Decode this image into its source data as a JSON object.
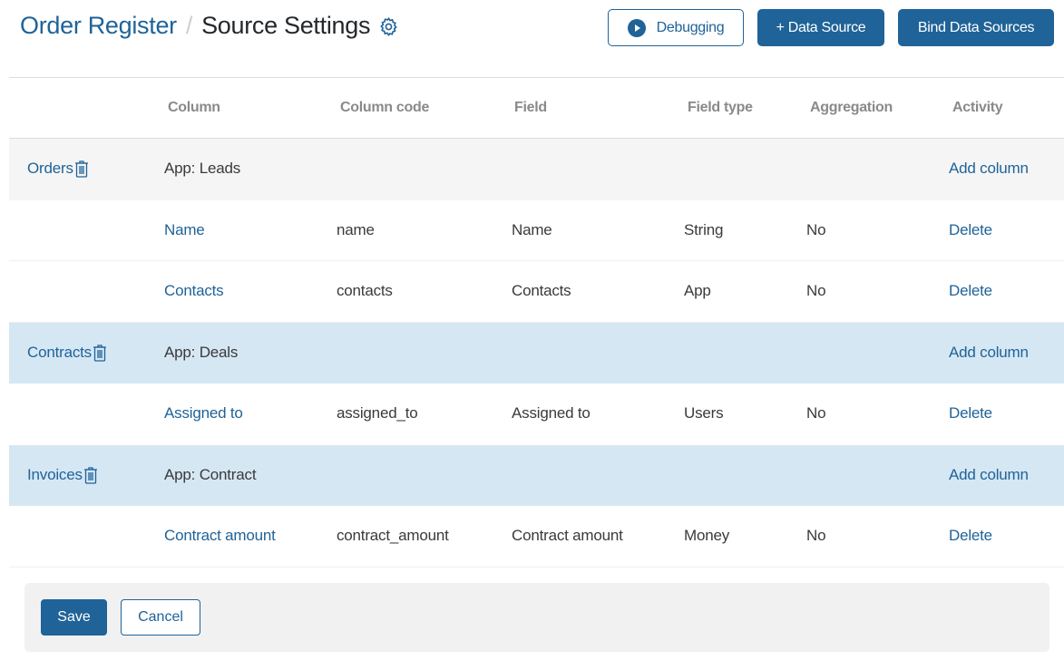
{
  "header": {
    "breadcrumb_parent": "Order Register",
    "breadcrumb_separator": "/",
    "page_title": "Source Settings",
    "settings_icon": "gear-icon"
  },
  "toolbar": {
    "debugging_label": "Debugging",
    "debugging_icon": "play-circle-icon",
    "add_data_source_label": "+ Data Source",
    "bind_data_sources_label": "Bind Data Sources"
  },
  "table": {
    "columns": [
      "Column",
      "Column code",
      "Field",
      "Field type",
      "Aggregation",
      "Activity"
    ],
    "groups": [
      {
        "source": "Orders",
        "app": "App: Leads",
        "action": "Add column",
        "rows": [
          {
            "column": "Name",
            "code": "name",
            "field": "Name",
            "type": "String",
            "aggregation": "No",
            "action": "Delete"
          },
          {
            "column": "Contacts",
            "code": "contacts",
            "field": "Contacts",
            "type": "App",
            "aggregation": "No",
            "action": "Delete"
          }
        ]
      },
      {
        "source": "Contracts",
        "app": "App: Deals",
        "action": "Add column",
        "rows": [
          {
            "column": "Assigned to",
            "code": "assigned_to",
            "field": "Assigned to",
            "type": "Users",
            "aggregation": "No",
            "action": "Delete"
          }
        ]
      },
      {
        "source": "Invoices",
        "app": "App: Contract",
        "action": "Add column",
        "rows": [
          {
            "column": "Contract amount",
            "code": "contract_amount",
            "field": "Contract amount",
            "type": "Money",
            "aggregation": "No",
            "action": "Delete"
          }
        ]
      }
    ]
  },
  "footer": {
    "save_label": "Save",
    "cancel_label": "Cancel"
  },
  "colors": {
    "accent": "#1f6398",
    "group_row_grey": "#f5f5f5",
    "group_row_blue": "#d6e7f4",
    "footer_bg": "#f1f1f1"
  }
}
